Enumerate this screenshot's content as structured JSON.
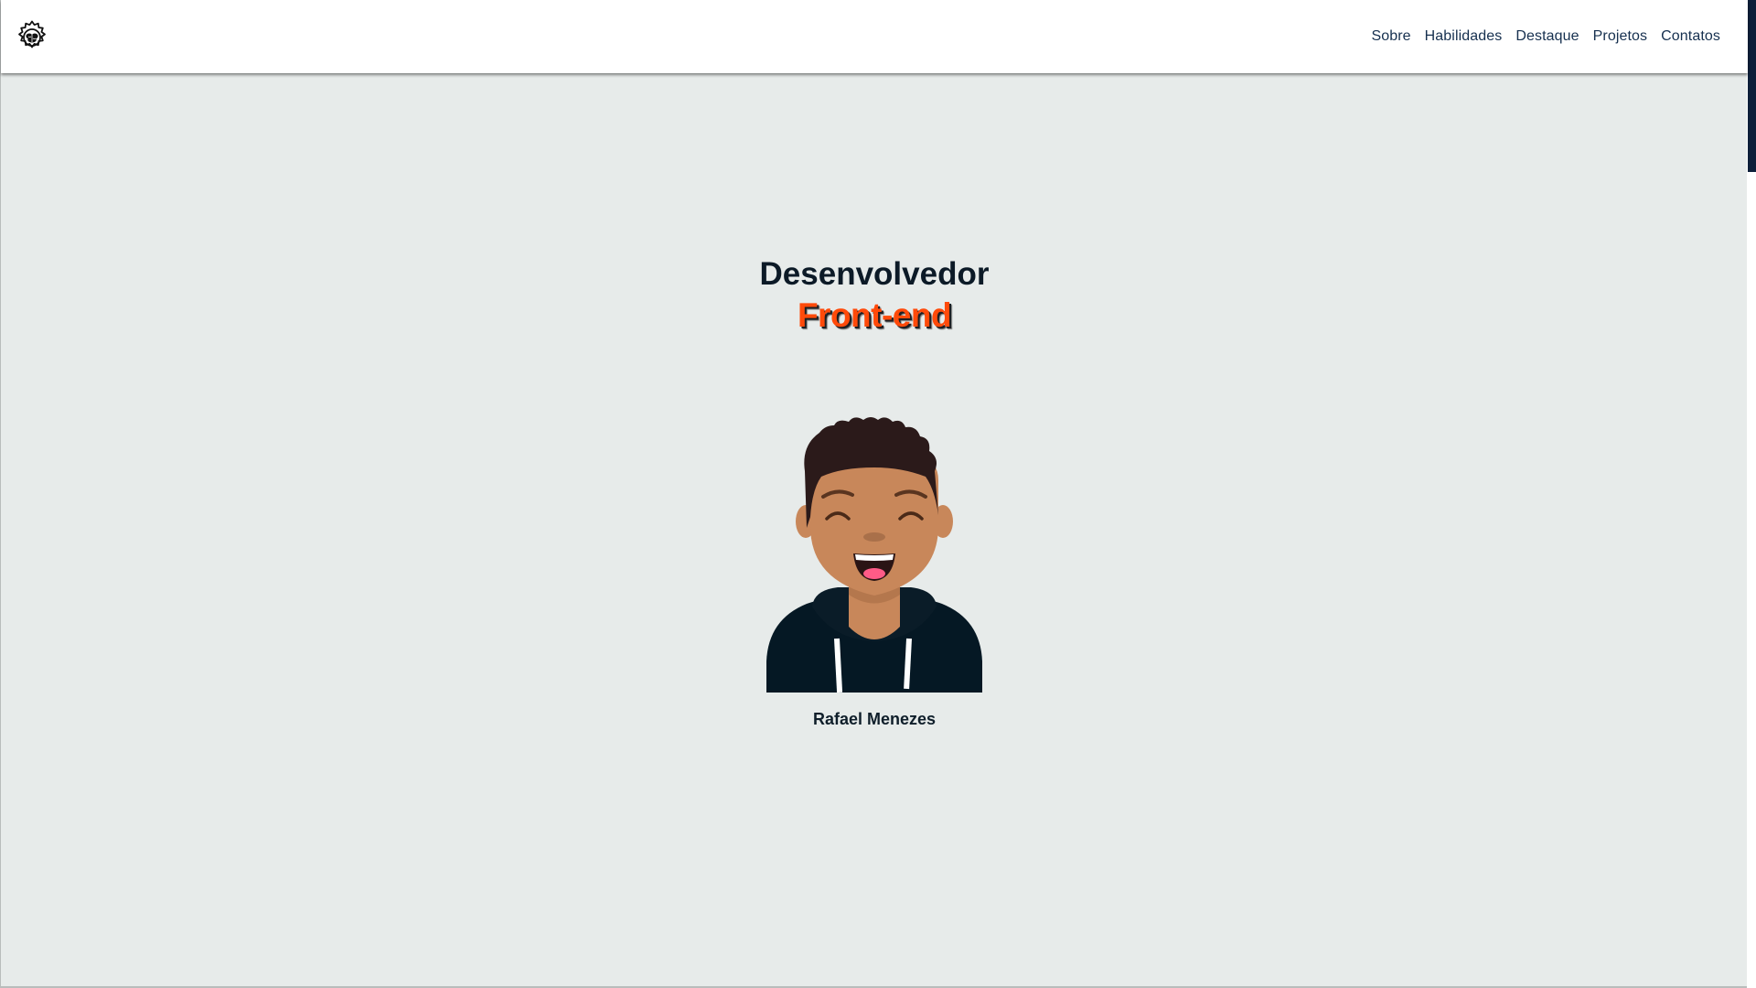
{
  "header": {
    "logo_icon": "gear-brain-icon",
    "nav": [
      {
        "label": "Sobre"
      },
      {
        "label": "Habilidades"
      },
      {
        "label": "Destaque"
      },
      {
        "label": "Projetos"
      },
      {
        "label": "Contatos"
      }
    ]
  },
  "hero": {
    "title_line1": "Desenvolvedor",
    "title_line2": "Front-end",
    "name": "Rafael Menezes",
    "avatar_icon": "person-avatar-illustration"
  },
  "colors": {
    "background": "#e7ebea",
    "accent": "#ff4a0a",
    "dark": "#0c1a27",
    "nav_text": "#16304f",
    "scroll_thumb": "#0d1f3a"
  }
}
